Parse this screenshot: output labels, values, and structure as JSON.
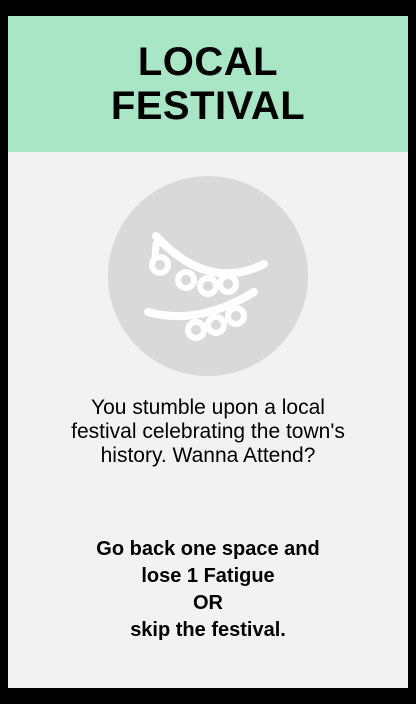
{
  "card": {
    "title_line1": "LOCAL",
    "title_line2": "FESTIVAL",
    "icon": "festival-bunting-icon",
    "description": "You stumble upon a local festival celebrating the town's history. Wanna Attend?",
    "option_primary_line1": "Go back one space and",
    "option_primary_line2": "lose 1 Fatigue",
    "separator": "OR",
    "option_secondary": "skip the festival."
  },
  "colors": {
    "page_background": "#000000",
    "card_background": "#f2f2f2",
    "header_background": "#a8e6c5",
    "emblem_background": "#d9d9d9",
    "icon_color": "#ffffff",
    "text": "#000000"
  }
}
